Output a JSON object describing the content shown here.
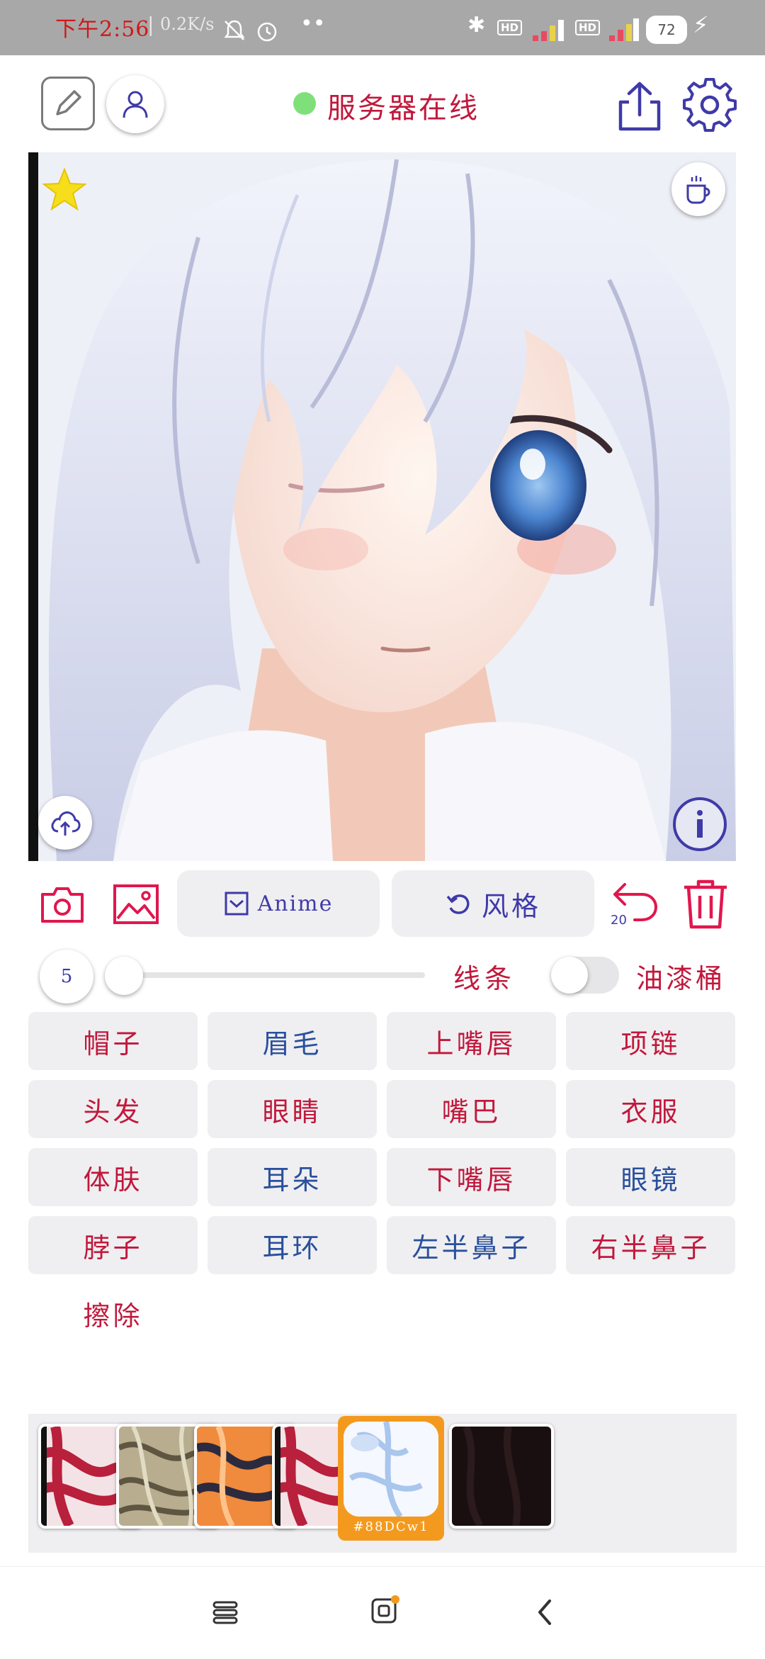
{
  "status_bar": {
    "time": "下午2:56",
    "net_speed": "0.2K/s",
    "hd1": "HD",
    "hd2": "HD",
    "battery": "72"
  },
  "top_bar": {
    "server_status": "服务器在线",
    "online_color": "#7fe07a",
    "icons": [
      "edit-icon",
      "user-icon",
      "share-icon",
      "gear-icon"
    ]
  },
  "image": {
    "icons": [
      "star-icon",
      "coffee-icon",
      "upload-icon",
      "info-icon"
    ]
  },
  "toolbar": {
    "model_label": "Anime",
    "style_label": "风格",
    "undo_count": "20",
    "icons": [
      "camera-icon",
      "gallery-icon",
      "checkbox-icon",
      "redo-icon",
      "undo-icon",
      "trash-icon"
    ]
  },
  "brush": {
    "size": "5",
    "size_value": 0,
    "lines_label": "线条",
    "lines_on": false,
    "bucket_label": "油漆桶"
  },
  "parts": [
    {
      "label": "帽子",
      "color": "red"
    },
    {
      "label": "眉毛",
      "color": "blue"
    },
    {
      "label": "上嘴唇",
      "color": "red"
    },
    {
      "label": "项链",
      "color": "red"
    },
    {
      "label": "头发",
      "color": "red"
    },
    {
      "label": "眼睛",
      "color": "red"
    },
    {
      "label": "嘴巴",
      "color": "red"
    },
    {
      "label": "衣服",
      "color": "red"
    },
    {
      "label": "体肤",
      "color": "red"
    },
    {
      "label": "耳朵",
      "color": "blue"
    },
    {
      "label": "下嘴唇",
      "color": "red"
    },
    {
      "label": "眼镜",
      "color": "blue"
    },
    {
      "label": "脖子",
      "color": "red"
    },
    {
      "label": "耳环",
      "color": "blue"
    },
    {
      "label": "左半鼻子",
      "color": "blue"
    },
    {
      "label": "右半鼻子",
      "color": "red"
    }
  ],
  "erase_label": "擦除",
  "swatches": {
    "selected_index": 4,
    "selected_caption": "#88DCw1",
    "selected_border": "#f39a1e"
  },
  "nav": {
    "icons": [
      "menu-icon",
      "home-icon",
      "back-icon"
    ]
  }
}
